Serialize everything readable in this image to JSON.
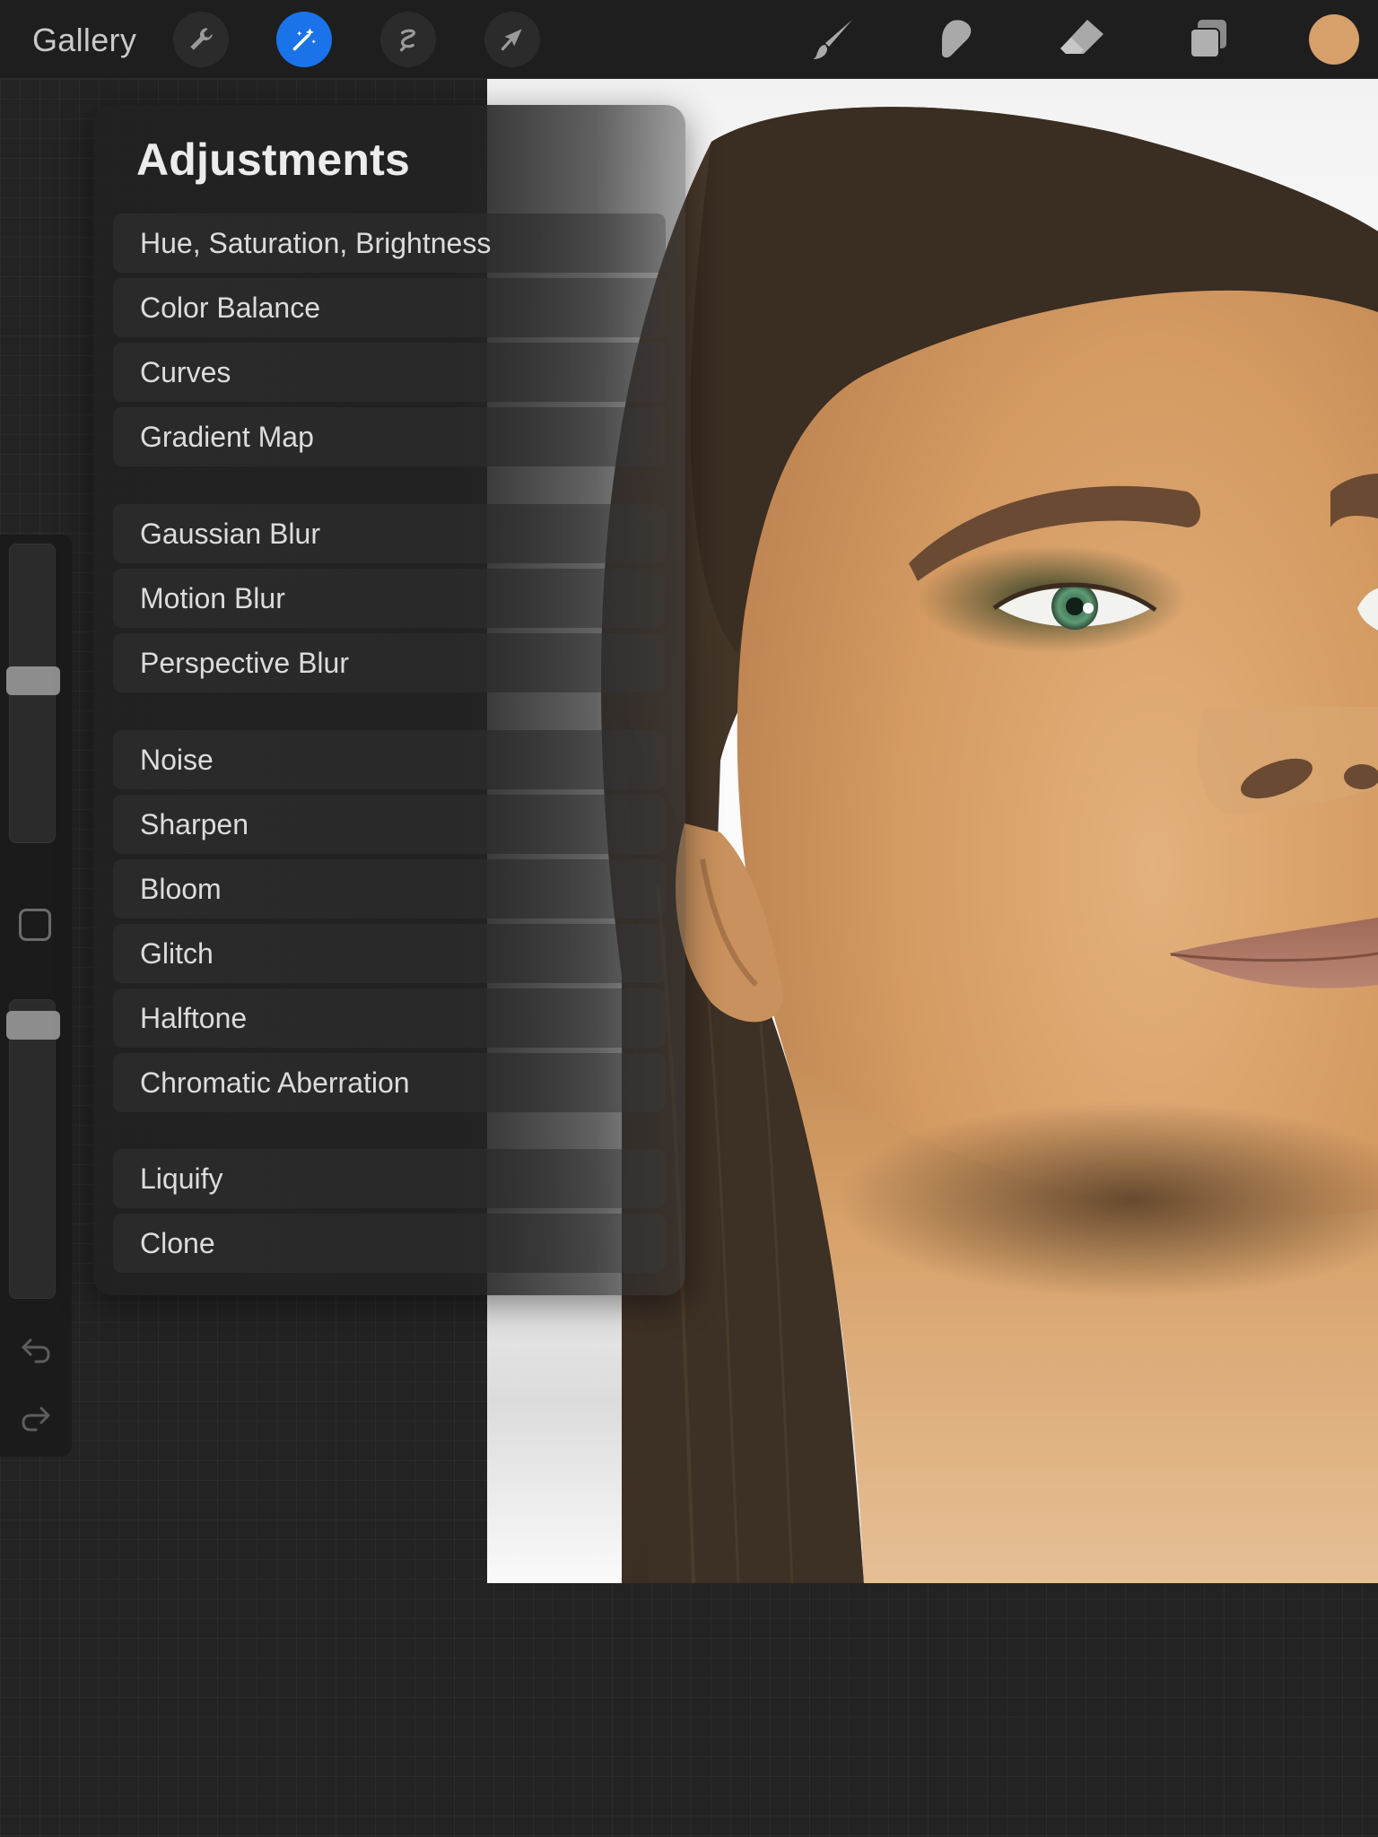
{
  "toolbar": {
    "gallery_label": "Gallery",
    "left_tools": [
      "wrench-icon",
      "magic-wand-icon",
      "selection-icon",
      "transform-arrow-icon"
    ],
    "active_tool": "magic-wand-icon",
    "right_tools": [
      "brush-icon",
      "smudge-icon",
      "eraser-icon",
      "layers-icon"
    ],
    "current_color": "#d7a06b",
    "accent_color": "#1a73e8"
  },
  "adjustments": {
    "title": "Adjustments",
    "items": [
      "Hue, Saturation, Brightness",
      "Color Balance",
      "Curves",
      "Gradient Map",
      "Gaussian Blur",
      "Motion Blur",
      "Perspective Blur",
      "Noise",
      "Sharpen",
      "Bloom",
      "Glitch",
      "Halftone",
      "Chromatic Aberration",
      "Liquify",
      "Clone"
    ]
  },
  "sidebar": {
    "brush_size_level": 0.55,
    "opacity_level": 0.96,
    "icons": [
      "modify-square-icon",
      "undo-icon",
      "redo-icon"
    ]
  }
}
